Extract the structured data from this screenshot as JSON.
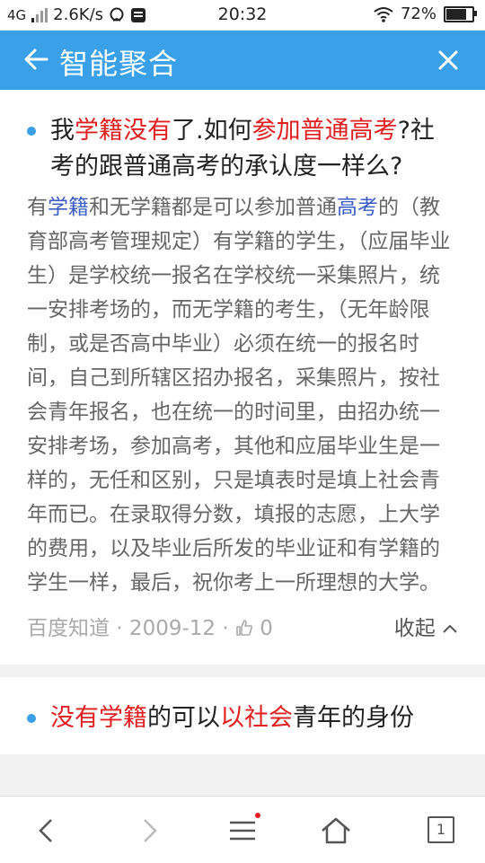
{
  "status_bar": {
    "network": "4G",
    "speed": "2.6K/s",
    "time": "20:32",
    "battery": "72%",
    "battery_level": 0.72
  },
  "app_bar": {
    "title": "智能聚合",
    "back_icon": "arrow-left-icon",
    "close_icon": "close-icon"
  },
  "answer1": {
    "title_segments": [
      {
        "text": "我",
        "style": "normal"
      },
      {
        "text": "学籍",
        "style": "red"
      },
      {
        "text": "没有",
        "style": "red"
      },
      {
        "text": "了.如何",
        "style": "normal"
      },
      {
        "text": "参加普通",
        "style": "red"
      },
      {
        "text": "高考",
        "style": "red"
      },
      {
        "text": "?社考的跟普通高考的承认度一样么?",
        "style": "normal"
      }
    ],
    "body_segments": [
      {
        "text": "有",
        "style": "normal"
      },
      {
        "text": "学籍",
        "style": "blue"
      },
      {
        "text": "和无学籍都是可以参加普通",
        "style": "normal"
      },
      {
        "text": "高考",
        "style": "blue"
      },
      {
        "text": "的（教育部高考管理规定）有学籍的学生，（应届毕业生）是学校统一报名在学校统一采集照片，统一安排考场的，而无学籍的考生，（无年龄限制，或是否高中毕业）必须在统一的报名时间，自己到所辖区招办报名，采集照片，按社会青年报名，也在统一的时间里，由招办统一安排考场，参加高考，其他和应届毕业生是一样的，无任和区别，只是填表时是填上社会青年而已。在录取得分数，填报的志愿，上大学的费用，以及毕业后所发的毕业证和有学籍的学生一样，最后，祝你考上一所理想的大学。",
        "style": "normal"
      }
    ],
    "source": "百度知道 · 2009-12 · ",
    "likes": "0",
    "collapse_label": "收起"
  },
  "answer2": {
    "title_segments": [
      {
        "text": "没有",
        "style": "red"
      },
      {
        "text": "学籍",
        "style": "red"
      },
      {
        "text": "的可以",
        "style": "normal"
      },
      {
        "text": "以社会",
        "style": "red"
      },
      {
        "text": "青年的身份",
        "style": "normal"
      }
    ]
  },
  "bottom_nav": {
    "tab_count": "1",
    "icons": [
      "back-icon",
      "forward-icon",
      "menu-icon",
      "home-icon",
      "tabs-icon"
    ]
  },
  "colors": {
    "accent": "#3aa0e8",
    "highlight_red": "#e02020",
    "highlight_blue": "#3b5cc4"
  }
}
